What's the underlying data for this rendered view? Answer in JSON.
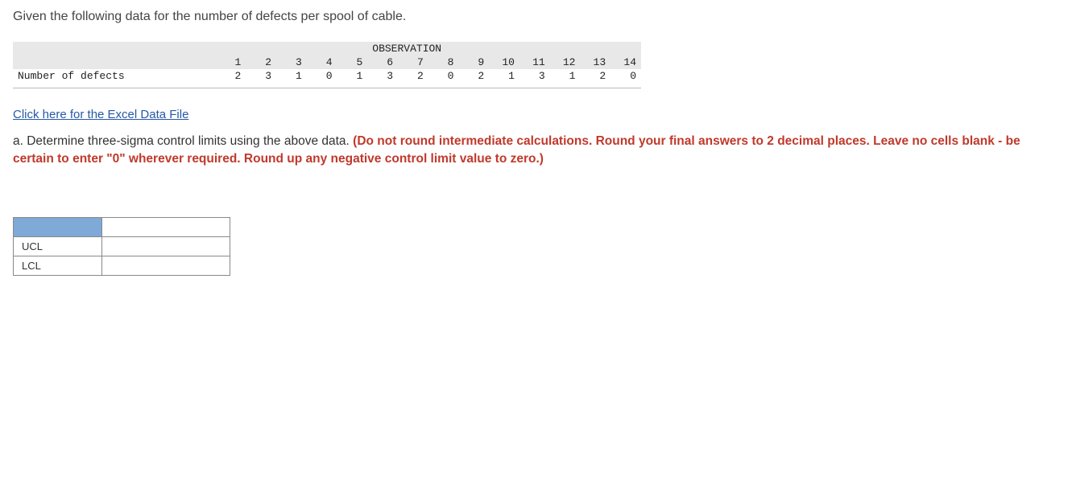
{
  "intro": "Given the following data for the number of defects per spool of cable.",
  "table": {
    "obs_header": "OBSERVATION",
    "row_label": "Number of defects",
    "columns": [
      "1",
      "2",
      "3",
      "4",
      "5",
      "6",
      "7",
      "8",
      "9",
      "10",
      "11",
      "12",
      "13",
      "14"
    ],
    "values": [
      "2",
      "3",
      "1",
      "0",
      "1",
      "3",
      "2",
      "0",
      "2",
      "1",
      "3",
      "1",
      "2",
      "0"
    ]
  },
  "link_text": "Click here for the Excel Data File",
  "question": {
    "prefix": "a. Determine three-sigma control limits using the above data. ",
    "red": "(Do not round intermediate calculations. Round your final answers to 2 decimal places. Leave no cells blank - be certain to enter \"0\" wherever required. Round up any negative control limit value to zero.)"
  },
  "answers": {
    "ucl_label": "UCL",
    "lcl_label": "LCL",
    "ucl_value": "",
    "lcl_value": ""
  }
}
